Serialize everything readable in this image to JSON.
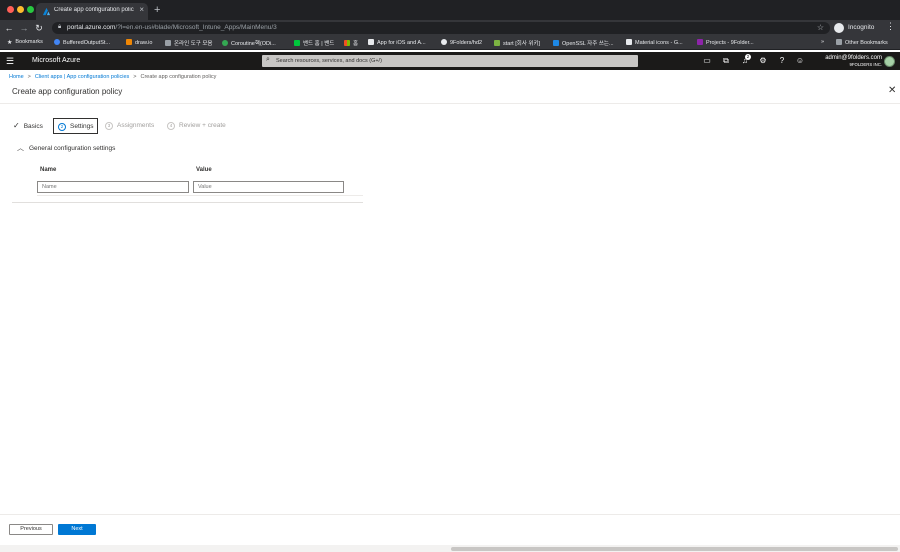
{
  "browser": {
    "tab_title": "Create app configuration polic",
    "new_tab": "+",
    "url_host": "portal.azure.com",
    "url_path": "/?l=en.en-us#blade/Microsoft_Intune_Apps/MainMenu/3",
    "incognito_label": "Incognito"
  },
  "bookmarks": {
    "items": [
      {
        "label": "Bookmarks",
        "color": "#e8eaed"
      },
      {
        "label": "BufferedOutputSt...",
        "color": "#4285f4"
      },
      {
        "label": "draw.io",
        "color": "#f08705"
      },
      {
        "label": "온라인 도구 모음",
        "color": "#5f6368"
      },
      {
        "label": "Coroutine핵(ODi...",
        "color": "#34a853"
      },
      {
        "label": "밴드 홈 | 밴드",
        "color": "#00c73c"
      },
      {
        "label": "홈",
        "color": "#f25022"
      },
      {
        "label": "App for iOS and A...",
        "color": "#e8eaed"
      },
      {
        "label": "9Folders/hd2",
        "color": "#e8eaed"
      },
      {
        "label": "start [회사 위키]",
        "color": "#7cb342"
      },
      {
        "label": "OpenSSL 자주 쓰는...",
        "color": "#1e88e5"
      },
      {
        "label": "Material icons - G...",
        "color": "#e8eaed"
      },
      {
        "label": "Projects - 9Folder...",
        "color": "#8e24aa"
      }
    ],
    "more": "»",
    "other": "Other Bookmarks"
  },
  "azure": {
    "brand": "Microsoft Azure",
    "search_placeholder": "Search resources, services, and docs (G+/)",
    "notification_count": "2",
    "user_email": "admin@9folders.com",
    "user_tenant": "9FOLDERS INC."
  },
  "breadcrumb": {
    "home": "Home",
    "parent": "Client apps | App configuration policies",
    "current": "Create app configuration policy"
  },
  "page_title": "Create app configuration policy",
  "steps": [
    {
      "num": "",
      "label": "Basics"
    },
    {
      "num": "2",
      "label": "Settings"
    },
    {
      "num": "3",
      "label": "Assignments"
    },
    {
      "num": "4",
      "label": "Review + create"
    }
  ],
  "section": {
    "title": "General configuration settings",
    "col_name": "Name",
    "col_value": "Value",
    "name_placeholder": "Name",
    "value_placeholder": "Value"
  },
  "footer": {
    "previous": "Previous",
    "next": "Next"
  }
}
